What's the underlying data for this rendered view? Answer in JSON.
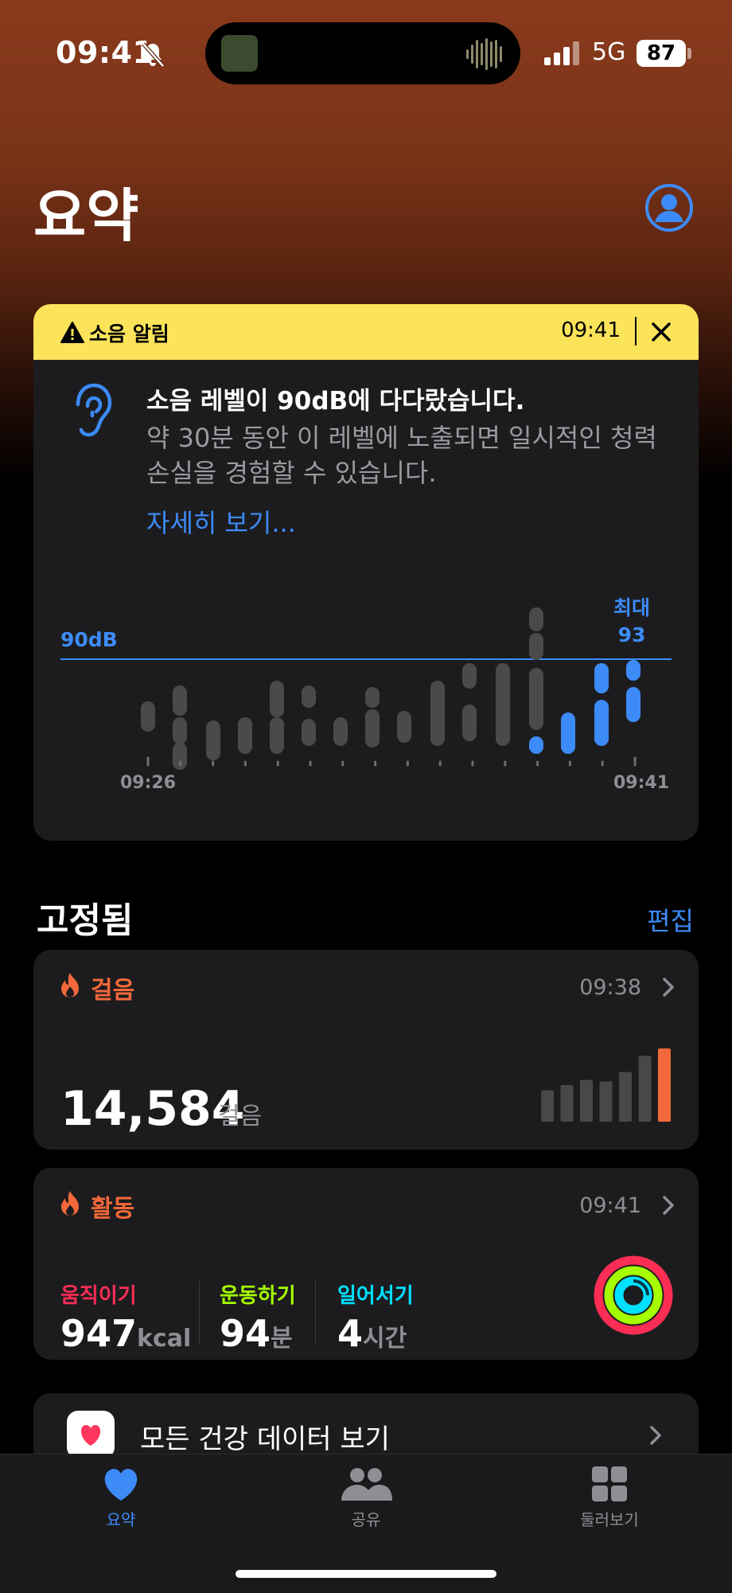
{
  "status_bar": {
    "time": "09:41",
    "network": "5G",
    "battery": "87"
  },
  "header": {
    "title": "요약"
  },
  "noise_alert": {
    "label": "소음 알림",
    "time": "09:41",
    "headline": "소음 레벨이 90dB에 다다랐습니다.",
    "body": "약 30분 동안 이 레벨에 노출되면 일시적인 청력 손실을 경험할 수 있습니다.",
    "link": "자세히 보기...",
    "chart_data": {
      "type": "range-bar",
      "threshold": {
        "label": "90dB",
        "value": 90
      },
      "max": {
        "label": "최대",
        "value": "93"
      },
      "x_labels": {
        "start": "09:26",
        "end": "09:41"
      },
      "accent": "#3d8bf7",
      "gray": "#4a4a4d"
    }
  },
  "pinned": {
    "title": "고정됨",
    "edit": "편집"
  },
  "steps": {
    "title": "걸음",
    "time": "09:38",
    "value": "14,584",
    "unit": "걸음",
    "bars": [
      0.43,
      0.5,
      0.57,
      0.55,
      0.68,
      0.9,
      1.0
    ],
    "accent": "#f2683a"
  },
  "activity": {
    "title": "활동",
    "time": "09:41",
    "move": {
      "label": "움직이기",
      "value": "947",
      "unit": "kcal",
      "color": "#fa2d55"
    },
    "exercise": {
      "label": "운동하기",
      "value": "94",
      "unit": "분",
      "color": "#a6ff00"
    },
    "stand": {
      "label": "일어서기",
      "value": "4",
      "unit": "시간",
      "color": "#00e0ff"
    }
  },
  "all_data": {
    "label": "모든 건강 데이터 보기"
  },
  "tabs": [
    {
      "label": "요약",
      "active": true
    },
    {
      "label": "공유",
      "active": false
    },
    {
      "label": "둘러보기",
      "active": false
    }
  ]
}
